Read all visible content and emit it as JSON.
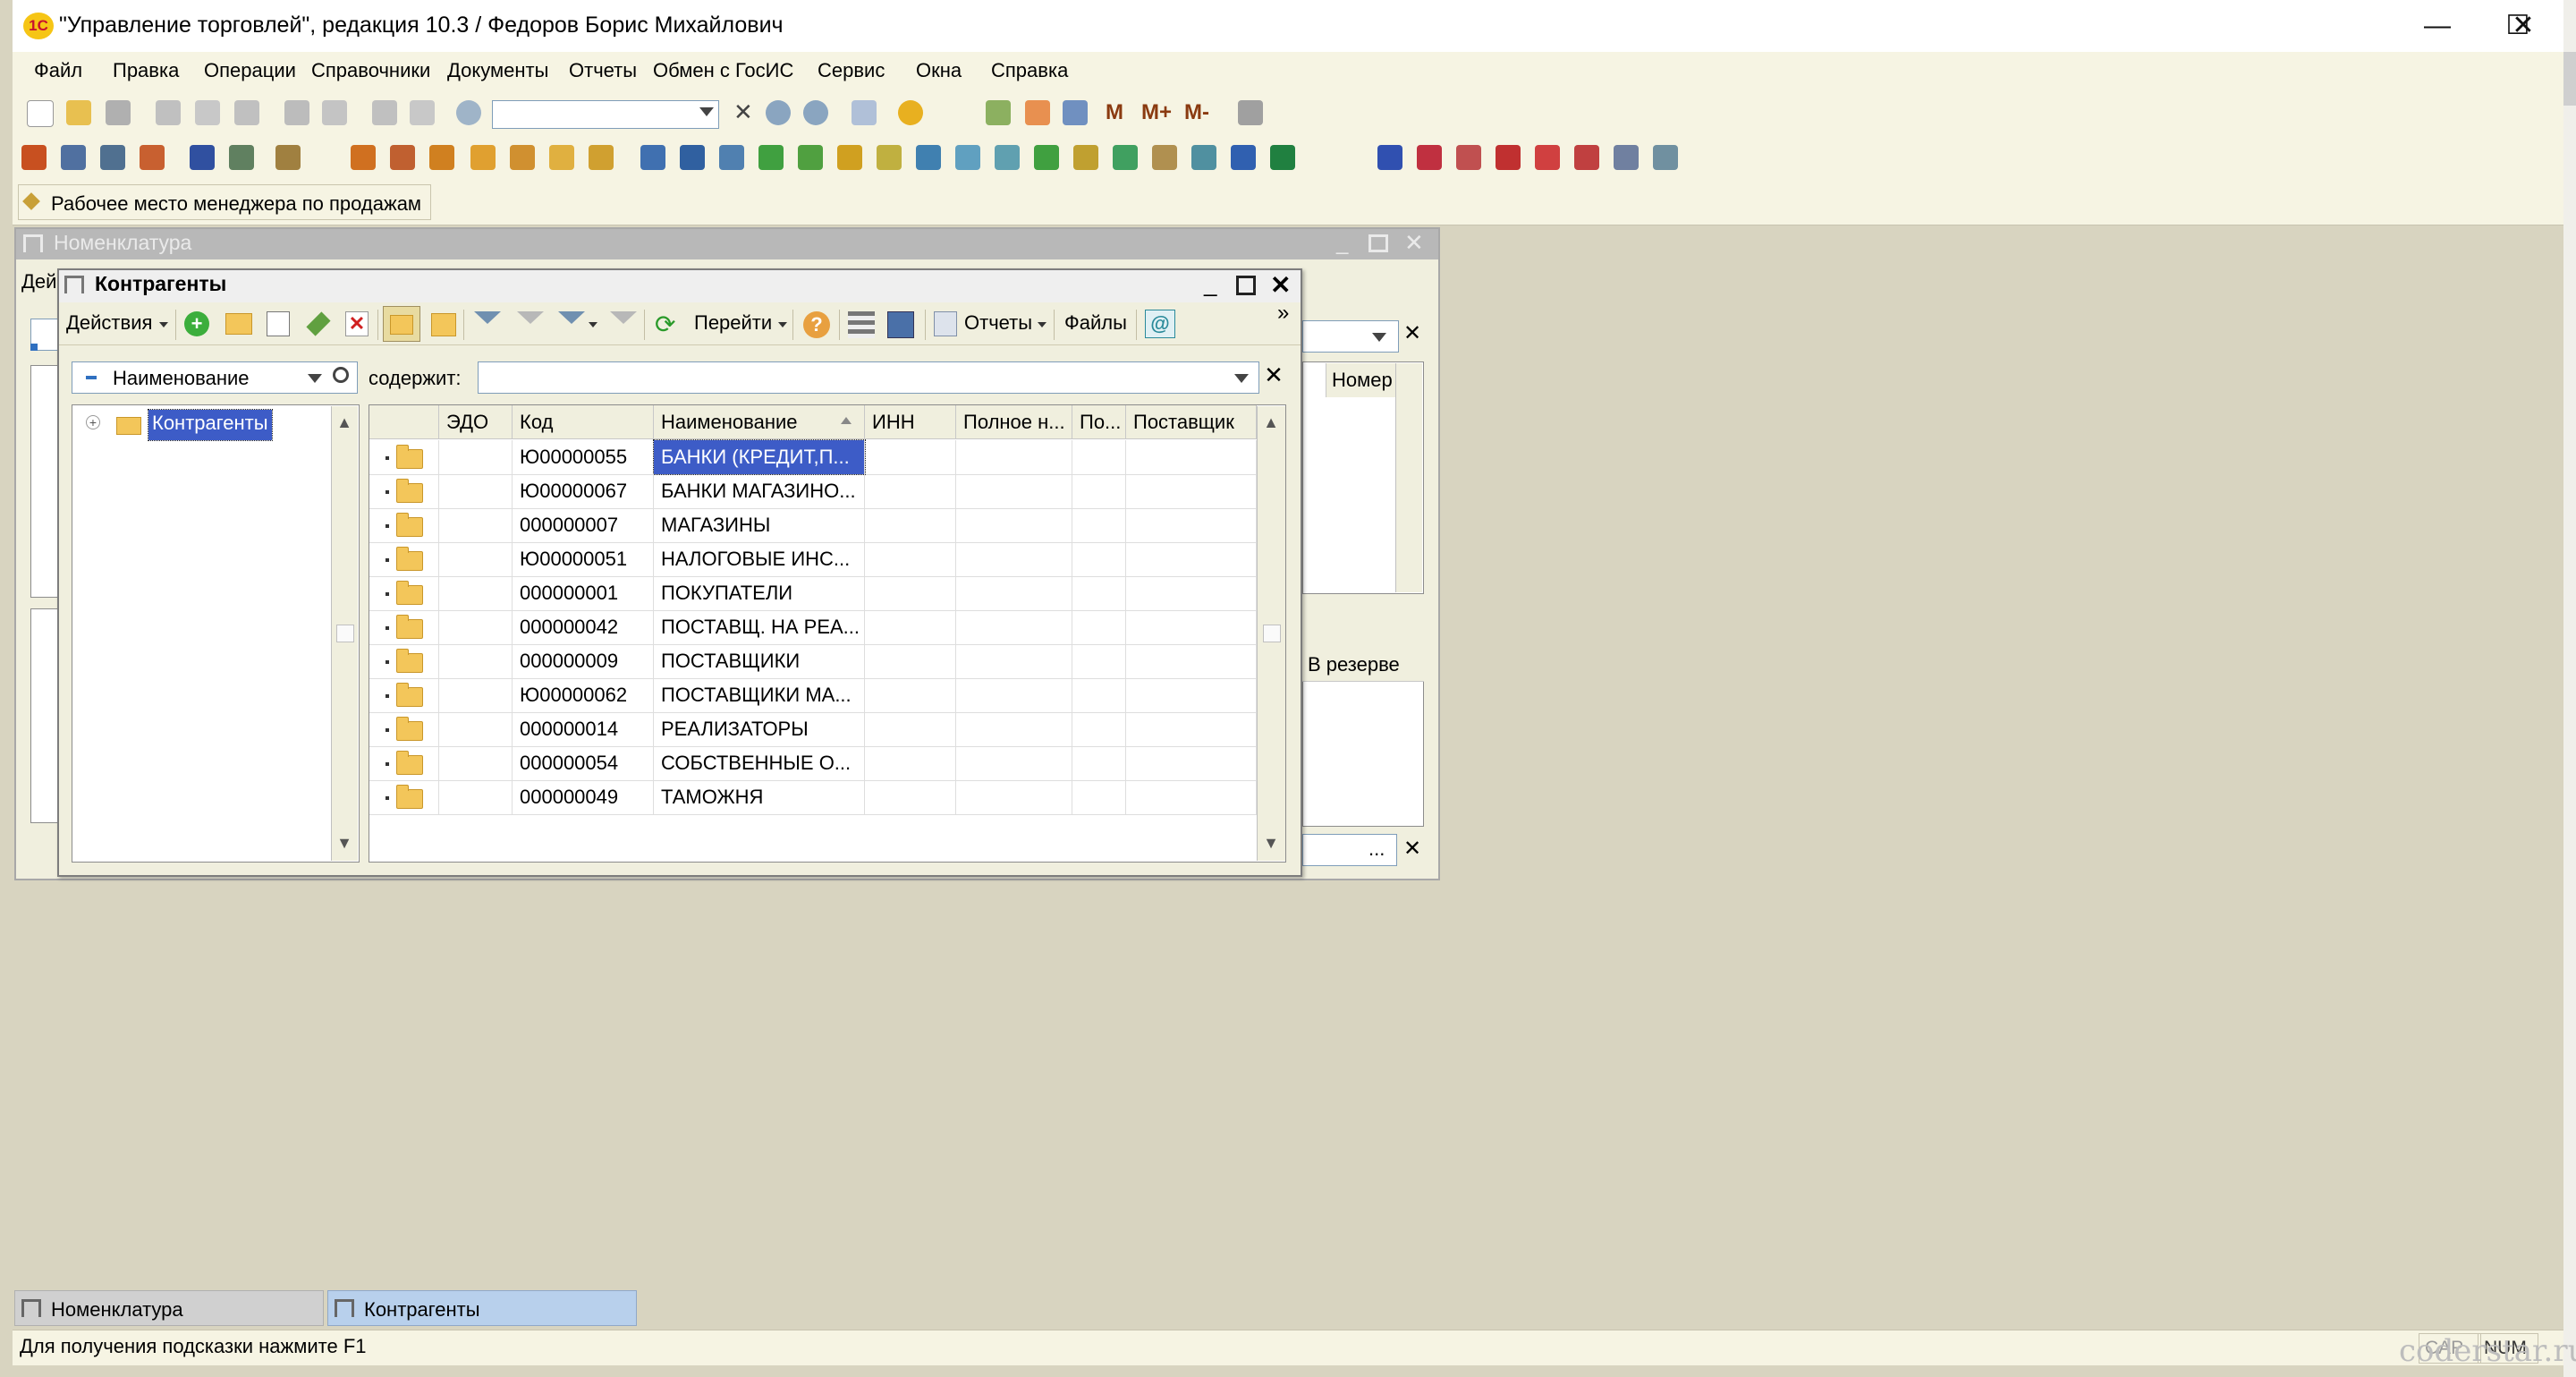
{
  "window": {
    "logo_text": "1С",
    "title": "\"Управление торговлей\", редакция 10.3 / Федоров Борис Михайлович",
    "minimize": "—",
    "maximize": "☐",
    "close": "✕"
  },
  "menu": [
    "Файл",
    "Правка",
    "Операции",
    "Справочники",
    "Документы",
    "Отчеты",
    "Обмен с ГосИС",
    "Сервис",
    "Окна",
    "Справка"
  ],
  "toolbar": {
    "m": "M",
    "m_plus": "M+",
    "m_minus": "M-"
  },
  "panel": {
    "workplace_label": "Рабочее место менеджера по продажам"
  },
  "nomenclature_window": {
    "title": "Номенклатура",
    "actions_partial": "Дей",
    "col_number": "Номер",
    "col_in_reserve": "В резерве"
  },
  "counterparties_window": {
    "title": "Контрагенты",
    "toolbar": {
      "actions": "Действия",
      "goto": "Перейти",
      "reports": "Отчеты",
      "files": "Файлы",
      "more": "»"
    },
    "search": {
      "field_value": "Наименование",
      "contains_label": "содержит:",
      "contains_value": ""
    },
    "tree": {
      "root": "Контрагенты"
    },
    "columns": [
      "ЭДО",
      "Код",
      "Наименование",
      "ИНН",
      "Полное н...",
      "По...",
      "Поставщик"
    ],
    "rows": [
      {
        "code": "Ю00000055",
        "name": "БАНКИ (КРЕДИТ,П..."
      },
      {
        "code": "Ю00000067",
        "name": "БАНКИ МАГАЗИНО..."
      },
      {
        "code": "000000007",
        "name": "МАГАЗИНЫ"
      },
      {
        "code": "Ю00000051",
        "name": "НАЛОГОВЫЕ ИНС..."
      },
      {
        "code": "000000001",
        "name": "ПОКУПАТЕЛИ"
      },
      {
        "code": "000000042",
        "name": "ПОСТАВЩ. НА РЕА..."
      },
      {
        "code": "000000009",
        "name": "ПОСТАВЩИКИ"
      },
      {
        "code": "Ю00000062",
        "name": "ПОСТАВЩИКИ МА..."
      },
      {
        "code": "000000014",
        "name": "РЕАЛИЗАТОРЫ"
      },
      {
        "code": "000000054",
        "name": "СОБСТВЕННЫЕ О..."
      },
      {
        "code": "000000049",
        "name": "ТАМОЖНЯ"
      }
    ]
  },
  "taskbar": [
    "Номенклатура",
    "Контрагенты"
  ],
  "status": {
    "hint": "Для получения подсказки нажмите F1",
    "cap": "CAP",
    "num": "NUM",
    "watermark": "coderstar.ru"
  },
  "colors": {
    "selection": "#3d5cc7",
    "window_bg": "#f0efde",
    "desktop_bg": "#d8d4c0"
  }
}
